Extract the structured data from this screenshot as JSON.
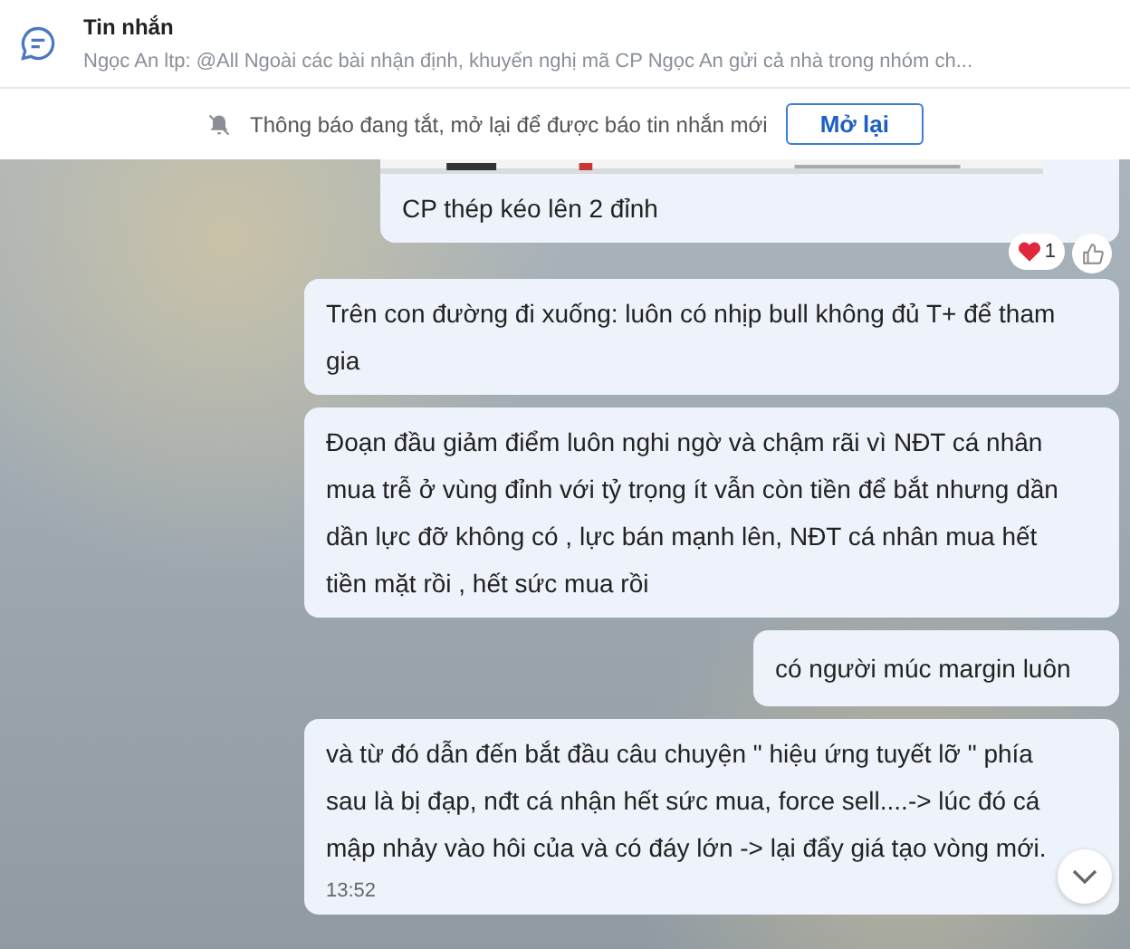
{
  "header": {
    "title": "Tin nhắn",
    "preview": "Ngọc An ltp: @All Ngoài các bài nhận định, khuyến nghị mã CP Ngọc An  gửi cả nhà trong nhóm ch..."
  },
  "notice": {
    "text": "Thông báo đang tắt, mở lại để được báo tin nhắn mới",
    "button": "Mở lại"
  },
  "messages": [
    {
      "text": "CP thép kéo lên 2 đỉnh",
      "reactions": {
        "count": "1"
      }
    },
    {
      "kind": "text",
      "text": "Trên con đường đi xuống: luôn có nhịp bull không đủ T+ để tham gia"
    },
    {
      "kind": "text",
      "text": "Đoạn đầu giảm điểm luôn nghi ngờ và chậm rãi vì  NĐT cá nhân mua trễ ở vùng đỉnh với tỷ trọng ít vẫn còn tiền để bắt nhưng dần dần lực đỡ không có , lực bán mạnh lên, NĐT cá nhân  mua hết tiền mặt rồi , hết sức mua rồi"
    },
    {
      "kind": "short",
      "text": "có người múc margin luôn"
    },
    {
      "kind": "text",
      "text": "và từ đó dẫn đến bắt đầu câu chuyện \" hiệu ứng tuyết lỡ \" phía sau là bị đạp, nđt cá nhận hết sức mua, force sell....-> lúc đó  cá mập nhảy vào hôi của và có đáy lớn -> lại đẩy giá tạo vòng mới.",
      "time": "13:52"
    }
  ]
}
